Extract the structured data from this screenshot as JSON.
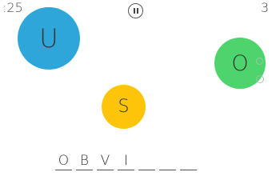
{
  "hud": {
    "timer": ":25",
    "score": "3",
    "pause_icon": "pause-icon"
  },
  "bubbles": [
    {
      "letter": "U",
      "color": "#2fa6da"
    },
    {
      "letter": "S",
      "color": "#fdc40a"
    },
    {
      "letter": "O",
      "color": "#4ed46c"
    }
  ],
  "word": {
    "slots": [
      "O",
      "B",
      "V",
      "I",
      "",
      "",
      ""
    ]
  }
}
